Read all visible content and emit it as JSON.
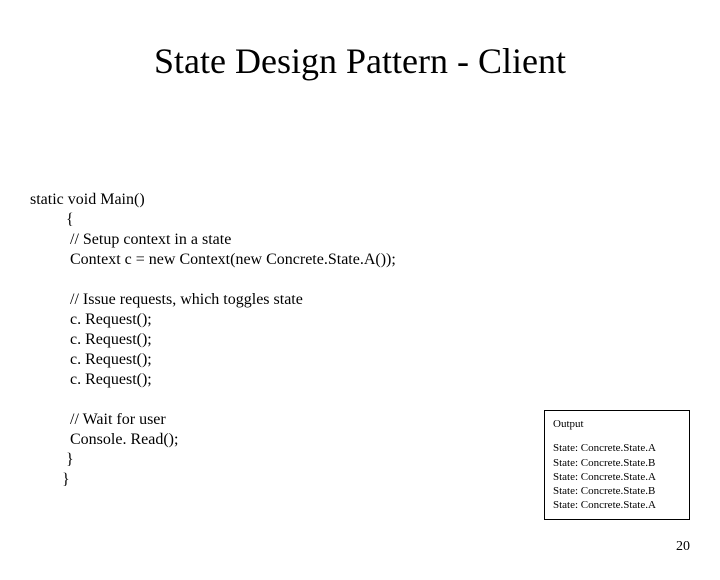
{
  "title": "State Design Pattern - Client",
  "code": {
    "l0": "static void Main()",
    "l1": "         {",
    "l2": "          // Setup context in a state",
    "l3": "          Context c = new Context(new Concrete.State.A());",
    "l4": "",
    "l5": "          // Issue requests, which toggles state",
    "l6": "          c. Request();",
    "l7": "          c. Request();",
    "l8": "          c. Request();",
    "l9": "          c. Request();",
    "l10": "",
    "l11": "          // Wait for user",
    "l12": "          Console. Read();",
    "l13": "         }",
    "l14": "        }"
  },
  "output": {
    "title": "Output",
    "lines": {
      "r0": "State: Concrete.State.A",
      "r1": "State: Concrete.State.B",
      "r2": "State: Concrete.State.A",
      "r3": "State: Concrete.State.B",
      "r4": "State: Concrete.State.A"
    }
  },
  "pageNumber": "20"
}
